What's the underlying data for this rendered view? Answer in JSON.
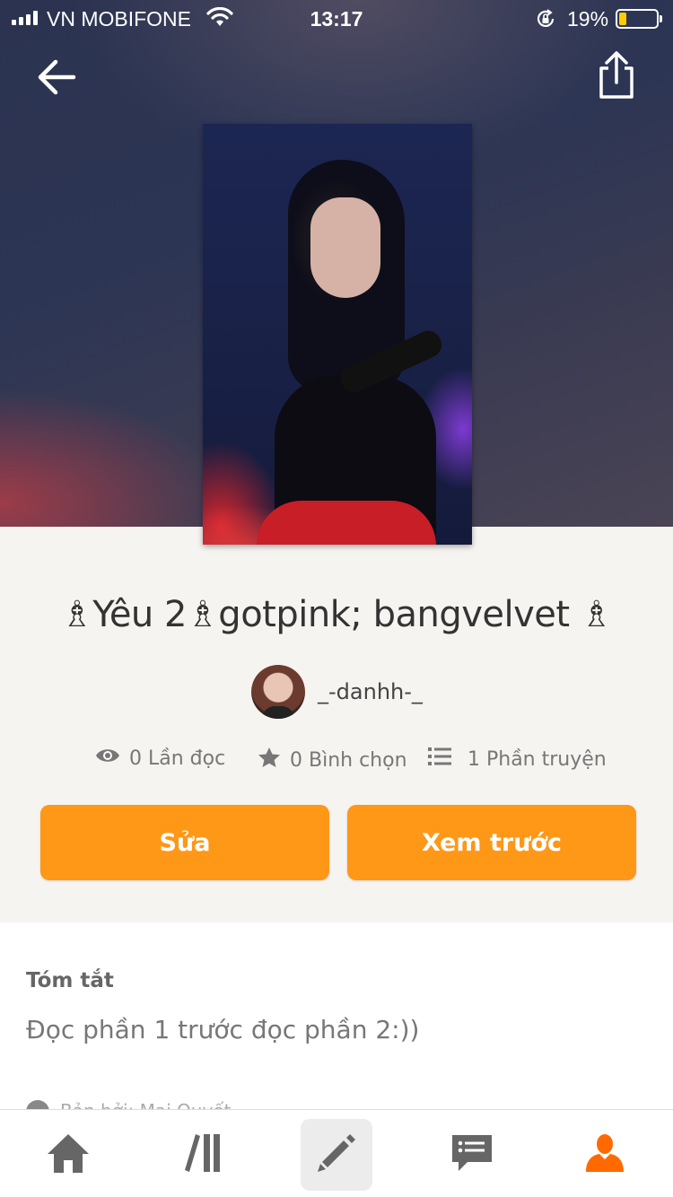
{
  "status_bar": {
    "carrier": "VN MOBIFONE",
    "time": "13:17",
    "battery_percent": "19%",
    "battery_level": 0.19
  },
  "nav": {
    "back_icon": "arrow-left-icon",
    "share_icon": "share-icon"
  },
  "story": {
    "cover_image": "story-cover-image",
    "title": "♗Yêu 2♗gotpink; bangvelvet ♗",
    "author": "_-danhh-_",
    "stats": {
      "reads": "0 Lần đọc",
      "votes": "0 Bình chọn",
      "parts": "1 Phần truyện"
    }
  },
  "actions": {
    "edit_label": "Sửa",
    "preview_label": "Xem trước"
  },
  "summary": {
    "heading": "Tóm tắt",
    "text": "Đọc phần 1 trước đọc phần 2:))",
    "peek_text": "Bản bởi: Mai Quyết"
  },
  "tabbar": {
    "items": [
      "home-icon",
      "library-icon",
      "write-icon",
      "messages-icon",
      "profile-icon"
    ],
    "active": "write-icon",
    "active_color": "#ff6a00",
    "accent": "#ff9717"
  }
}
